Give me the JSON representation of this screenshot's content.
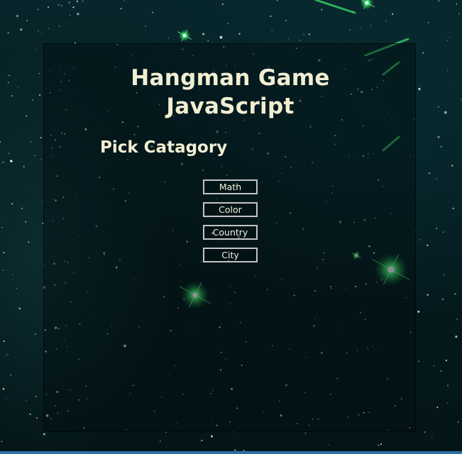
{
  "page": {
    "title_line1": "Hangman Game",
    "title_line2": "JavaScript",
    "subtitle": "Pick Catagory"
  },
  "categories": [
    "Math",
    "Color",
    "Country",
    "City"
  ],
  "colors": {
    "background": "#06191c",
    "text": "#f1eed2",
    "button_border": "#c4c4c4",
    "star_glow": "#3dff6a"
  }
}
